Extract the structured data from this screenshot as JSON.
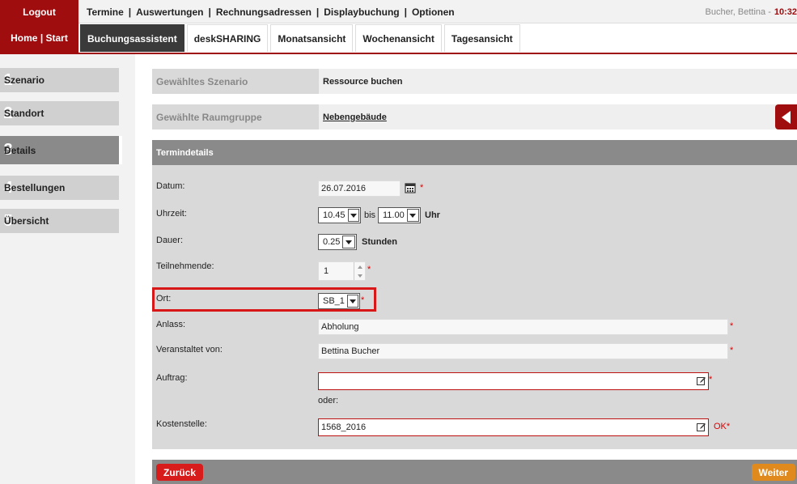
{
  "top": {
    "logout": "Logout",
    "menu": [
      "Termine",
      "Auswertungen",
      "Rechnungsadressen",
      "Displaybuchung",
      "Optionen"
    ],
    "user": "Bucher, Bettina -",
    "time": "10:32"
  },
  "nav": {
    "home": "Home | Start",
    "tabs": [
      "Buchungsassistent",
      "deskSHARING",
      "Monatsansicht",
      "Wochenansicht",
      "Tagesansicht"
    ],
    "active_tab": 0
  },
  "steps": [
    {
      "num": "1",
      "label": "Szenario"
    },
    {
      "num": "2",
      "label": "Standort"
    },
    {
      "num": "3",
      "label": "Details",
      "active": true
    },
    {
      "num": "4",
      "label": "Bestellungen"
    },
    {
      "num": "5",
      "label": "Übersicht"
    }
  ],
  "summary": {
    "scenario_key": "Gewähltes Szenario",
    "scenario_value": "Ressource buchen",
    "group_key": "Gewählte Raumgruppe",
    "group_value": "Nebengebäude"
  },
  "details": {
    "title": "Termindetails",
    "date_label": "Datum:",
    "date_value": "26.07.2016",
    "time_label": "Uhrzeit:",
    "time_from": "10.45",
    "time_bis": "bis",
    "time_to": "11.00",
    "time_unit": "Uhr",
    "duration_label": "Dauer:",
    "duration_value": "0.25",
    "duration_unit": "Stunden",
    "participants_label": "Teilnehmende:",
    "participants_value": "1",
    "location_label": "Ort:",
    "location_value": "SB_1",
    "occasion_label": "Anlass:",
    "occasion_value": "Abholung",
    "organizer_label": "Veranstaltet von:",
    "organizer_value": "Bettina Bucher",
    "order_label": "Auftrag:",
    "order_value": "",
    "or_text": "oder:",
    "cost_label": "Kostenstelle:",
    "cost_value": "1568_2016",
    "cost_status": "OK*",
    "required_mark": "*"
  },
  "buttons": {
    "back": "Zurück",
    "next": "Weiter"
  },
  "colors": {
    "brand": "#a00d0f",
    "back_button": "#d81c1c",
    "next_button": "#e08a1e",
    "highlight": "#d81818"
  }
}
